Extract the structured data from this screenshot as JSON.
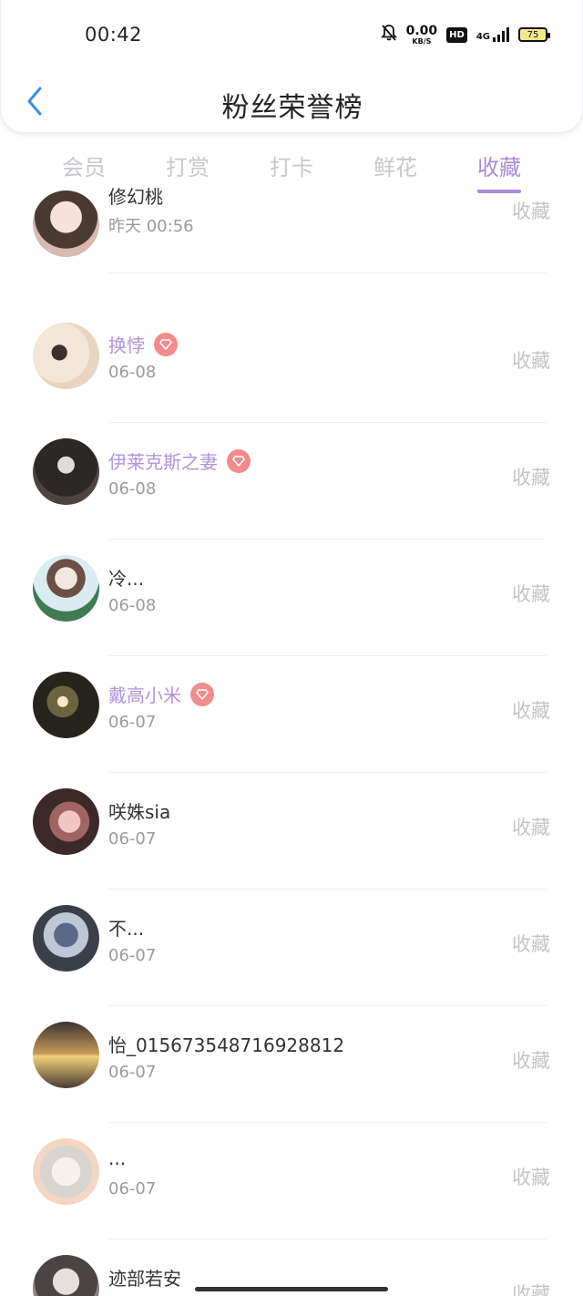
{
  "status_bar": {
    "time": "00:42",
    "speed_value": "0.00",
    "speed_unit": "KB/S",
    "hd": "HD",
    "network": "4G",
    "battery": "75"
  },
  "header": {
    "title": "粉丝荣誉榜"
  },
  "tabs": [
    {
      "label": "会员"
    },
    {
      "label": "打赏"
    },
    {
      "label": "打卡"
    },
    {
      "label": "鲜花"
    },
    {
      "label": "收藏"
    }
  ],
  "active_tab": "收藏",
  "accent_color": "#a98bdb",
  "list": [
    {
      "name": "修幻桃",
      "date": "昨天 00:56",
      "action": "收藏",
      "vip": false
    },
    {
      "name": "换悖",
      "date": "06-08",
      "action": "收藏",
      "vip": true
    },
    {
      "name": "伊莱克斯之妻",
      "date": "06-08",
      "action": "收藏",
      "vip": true
    },
    {
      "name": "冷...",
      "date": "06-08",
      "action": "收藏",
      "vip": false
    },
    {
      "name": "戴高小米",
      "date": "06-07",
      "action": "收藏",
      "vip": true
    },
    {
      "name": "咲姝sia",
      "date": "06-07",
      "action": "收藏",
      "vip": false
    },
    {
      "name": "不...",
      "date": "06-07",
      "action": "收藏",
      "vip": false
    },
    {
      "name": "怡_015673548716928812",
      "date": "06-07",
      "action": "收藏",
      "vip": false
    },
    {
      "name": "...",
      "date": "06-07",
      "action": "收藏",
      "vip": false
    },
    {
      "name": "迹部若安",
      "date": "",
      "action": "收藏",
      "vip": false
    }
  ]
}
